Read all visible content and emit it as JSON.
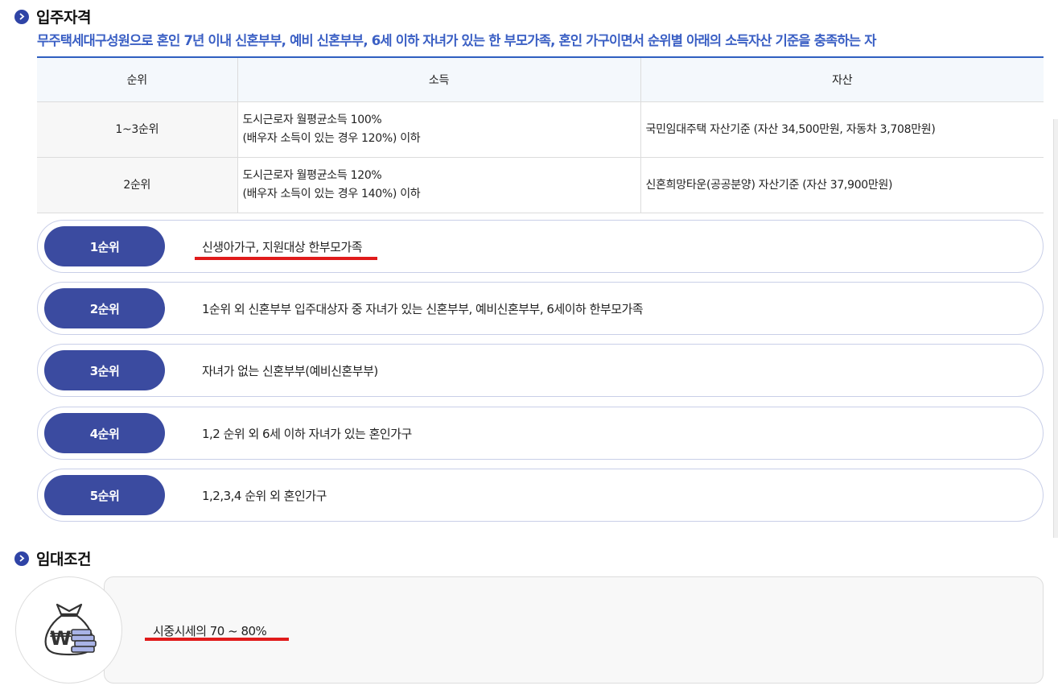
{
  "eligibility": {
    "heading": "입주자격",
    "description": "무주택세대구성원으로 혼인 7년 이내 신혼부부, 예비 신혼부부, 6세 이하 자녀가 있는 한 부모가족, 혼인 가구이면서 순위별 아래의 소득자산 기준을 충족하는 자",
    "table": {
      "headers": [
        "순위",
        "소득",
        "자산"
      ],
      "rows": [
        {
          "rank": "1~3순위",
          "income_line1": "도시근로자 월평균소득 100%",
          "income_line2": "(배우자 소득이 있는 경우 120%) 이하",
          "assets": "국민임대주택 자산기준 (자산 34,500만원, 자동차 3,708만원)"
        },
        {
          "rank": "2순위",
          "income_line1": "도시근로자 월평균소득 120%",
          "income_line2": "(배우자 소득이 있는 경우 140%) 이하",
          "assets": "신혼희망타운(공공분양) 자산기준 (자산 37,900만원)"
        }
      ]
    },
    "priorities": [
      {
        "rank": "1순위",
        "text": "신생아가구, 지원대상 한부모가족"
      },
      {
        "rank": "2순위",
        "text": "1순위 외 신혼부부 입주대상자 중 자녀가 있는 신혼부부, 예비신혼부부, 6세이하 한부모가족"
      },
      {
        "rank": "3순위",
        "text": "자녀가 없는 신혼부부(예비신혼부부)"
      },
      {
        "rank": "4순위",
        "text": "1,2 순위 외 6세 이하 자녀가 있는 혼인가구"
      },
      {
        "rank": "5순위",
        "text": "1,2,3,4 순위 외 혼인가구"
      }
    ]
  },
  "rental": {
    "heading": "임대조건",
    "text": "시중시세의 70 ~ 80%",
    "icon": "money-bag-icon"
  },
  "colors": {
    "accent": "#2f44a6",
    "badge": "#3b4ba0",
    "subtitle": "#3a5fc4",
    "highlight": "#e01b1b"
  }
}
